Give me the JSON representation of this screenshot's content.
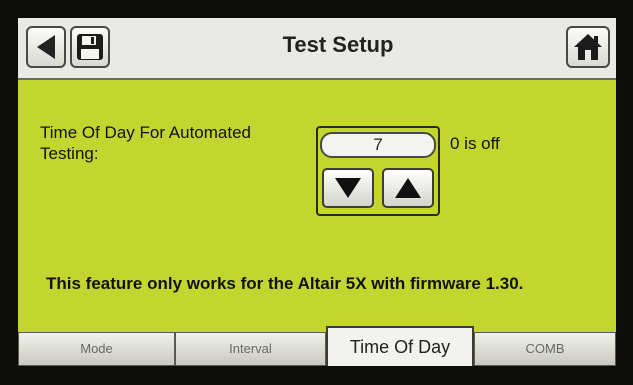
{
  "header": {
    "title": "Test Setup",
    "back_icon": "back-arrow-icon",
    "save_icon": "floppy-disk-icon",
    "home_icon": "home-icon"
  },
  "setting": {
    "label": "Time Of Day For Automated Testing:",
    "value": "7",
    "hint": "0 is off",
    "down_icon": "down-triangle-icon",
    "up_icon": "up-triangle-icon"
  },
  "note": "This feature only works for the Altair 5X with firmware 1.30.",
  "tabs": [
    {
      "label": "Mode",
      "active": false
    },
    {
      "label": "Interval",
      "active": false
    },
    {
      "label": "Time Of Day",
      "active": true
    },
    {
      "label": "COMB",
      "active": false
    }
  ],
  "colors": {
    "screen_bg": "#c3d630",
    "header_bg": "#e9e9e6"
  }
}
